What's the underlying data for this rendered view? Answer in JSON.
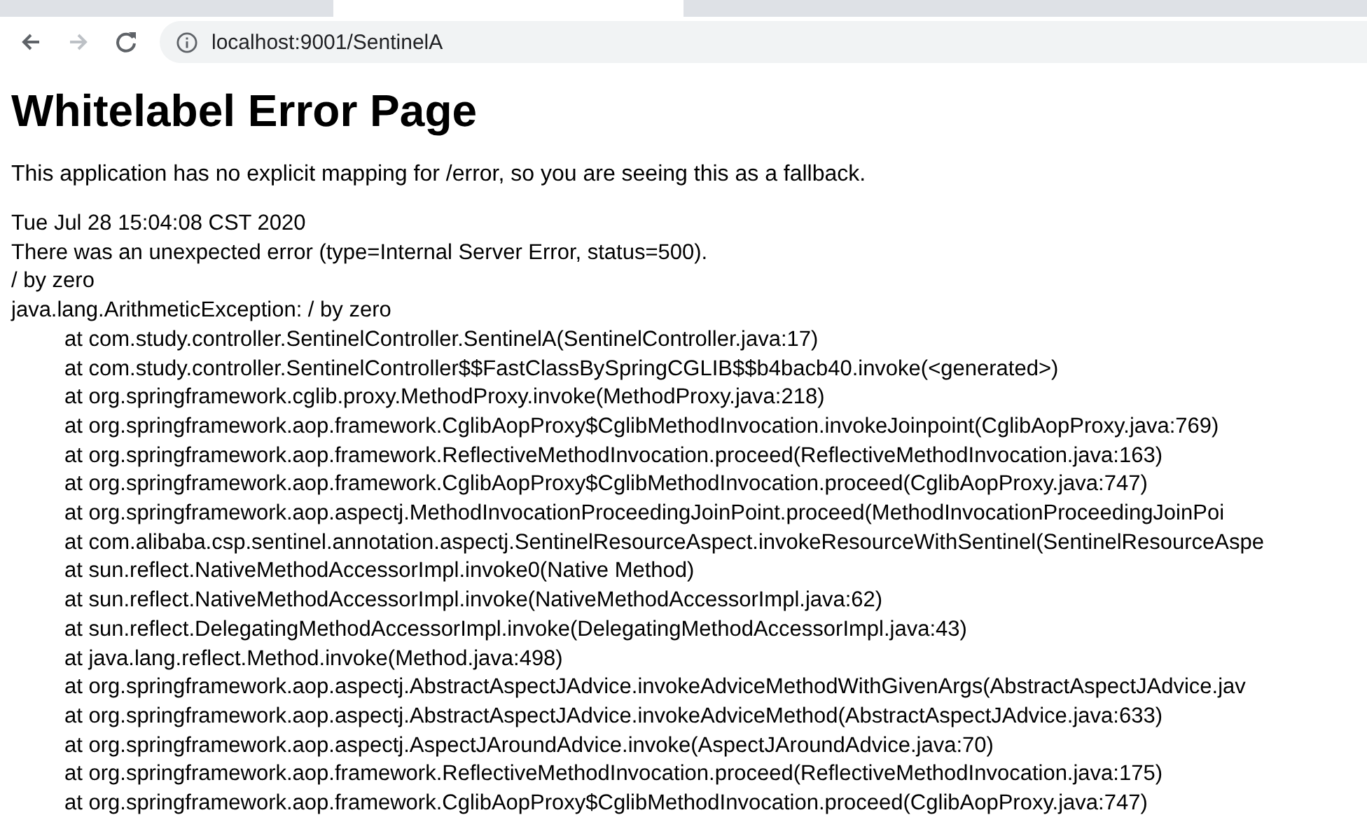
{
  "browser": {
    "nav_buttons": [
      {
        "kind": "back",
        "disabled": false
      },
      {
        "kind": "forward",
        "disabled": true
      },
      {
        "kind": "reload",
        "disabled": false
      }
    ],
    "url": "localhost:9001/SentinelA"
  },
  "page": {
    "title": "Whitelabel Error Page",
    "message": "This application has no explicit mapping for /error, so you are seeing this as a fallback.",
    "details": [
      "Tue Jul 28 15:04:08 CST 2020",
      "There was an unexpected error (type=Internal Server Error, status=500).",
      "/ by zero",
      "java.lang.ArithmeticException: / by zero"
    ],
    "stack": [
      "at com.study.controller.SentinelController.SentinelA(SentinelController.java:17)",
      "at com.study.controller.SentinelController$$FastClassBySpringCGLIB$$b4bacb40.invoke(<generated>)",
      "at org.springframework.cglib.proxy.MethodProxy.invoke(MethodProxy.java:218)",
      "at org.springframework.aop.framework.CglibAopProxy$CglibMethodInvocation.invokeJoinpoint(CglibAopProxy.java:769)",
      "at org.springframework.aop.framework.ReflectiveMethodInvocation.proceed(ReflectiveMethodInvocation.java:163)",
      "at org.springframework.aop.framework.CglibAopProxy$CglibMethodInvocation.proceed(CglibAopProxy.java:747)",
      "at org.springframework.aop.aspectj.MethodInvocationProceedingJoinPoint.proceed(MethodInvocationProceedingJoinPoi",
      "at com.alibaba.csp.sentinel.annotation.aspectj.SentinelResourceAspect.invokeResourceWithSentinel(SentinelResourceAspe",
      "at sun.reflect.NativeMethodAccessorImpl.invoke0(Native Method)",
      "at sun.reflect.NativeMethodAccessorImpl.invoke(NativeMethodAccessorImpl.java:62)",
      "at sun.reflect.DelegatingMethodAccessorImpl.invoke(DelegatingMethodAccessorImpl.java:43)",
      "at java.lang.reflect.Method.invoke(Method.java:498)",
      "at org.springframework.aop.aspectj.AbstractAspectJAdvice.invokeAdviceMethodWithGivenArgs(AbstractAspectJAdvice.jav",
      "at org.springframework.aop.aspectj.AbstractAspectJAdvice.invokeAdviceMethod(AbstractAspectJAdvice.java:633)",
      "at org.springframework.aop.aspectj.AspectJAroundAdvice.invoke(AspectJAroundAdvice.java:70)",
      "at org.springframework.aop.framework.ReflectiveMethodInvocation.proceed(ReflectiveMethodInvocation.java:175)",
      "at org.springframework.aop.framework.CglibAopProxy$CglibMethodInvocation.proceed(CglibAopProxy.java:747)"
    ]
  }
}
